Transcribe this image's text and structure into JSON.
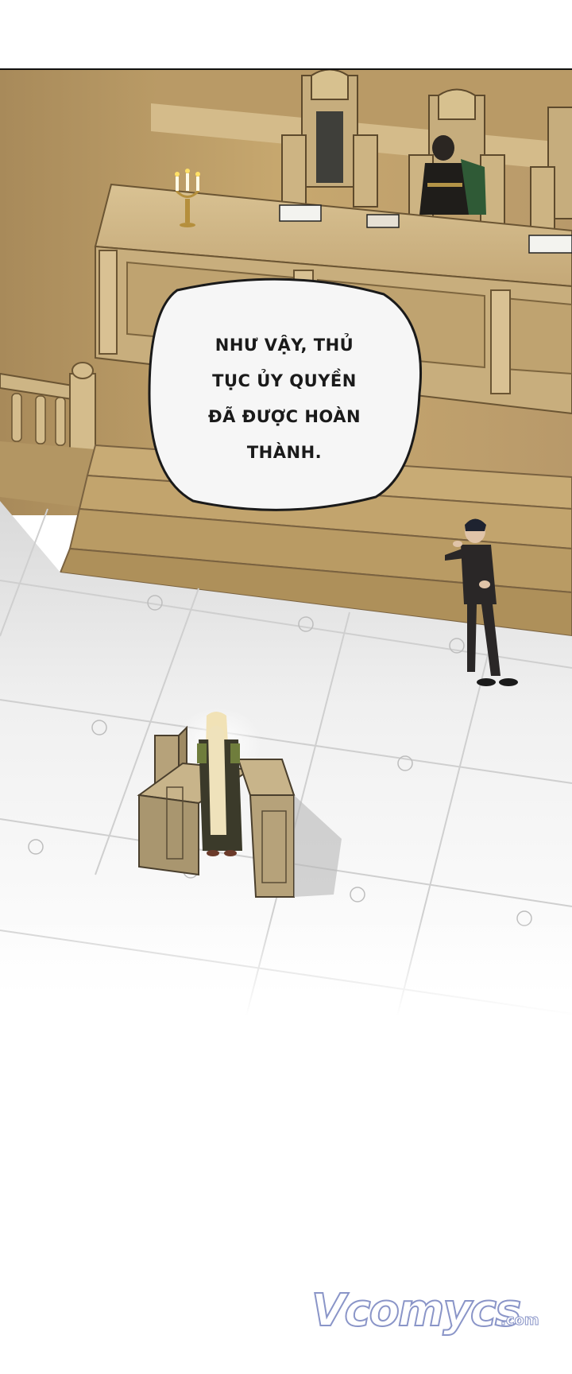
{
  "panel": {
    "scene": "courtroom"
  },
  "speech_bubble": {
    "lines": [
      "NHƯ VẬY, THỦ",
      "TỤC ỦY QUYỀN",
      "ĐÃ ĐƯỢC HOÀN",
      "THÀNH."
    ]
  },
  "watermark": {
    "brand": "Vcomycs",
    "suffix": ".com"
  },
  "colors": {
    "wood": "#c9ae7c",
    "wood_dark": "#8a7147",
    "floor": "#efefef",
    "bubble_fill": "#f6f6f6",
    "bubble_stroke": "#1a1a1a",
    "watermark_stroke": "#8a95c8"
  }
}
